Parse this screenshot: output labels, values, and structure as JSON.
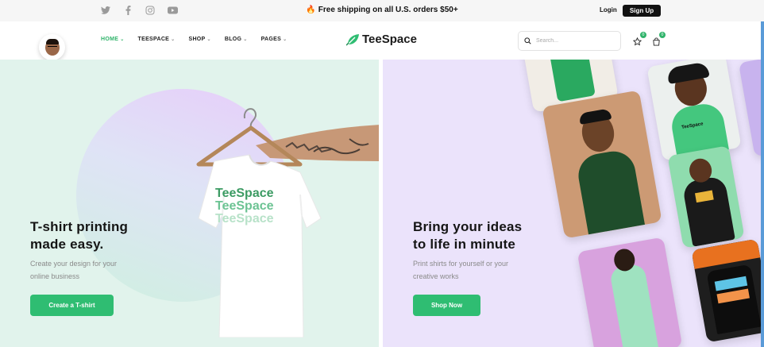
{
  "topbar": {
    "social": [
      "twitter-icon",
      "facebook-icon",
      "instagram-icon",
      "youtube-icon"
    ],
    "promo": "Free shipping on all U.S. orders $50+",
    "login": "Login",
    "signup": "Sign Up"
  },
  "nav": {
    "items": [
      {
        "label": "HOME",
        "active": true
      },
      {
        "label": "TEESPACE",
        "active": false
      },
      {
        "label": "SHOP",
        "active": false
      },
      {
        "label": "BLOG",
        "active": false
      },
      {
        "label": "PAGES",
        "active": false
      }
    ],
    "brand": "TeeSpace",
    "search_placeholder": "Search...",
    "wishlist_count": "0",
    "cart_count": "0"
  },
  "hero_left": {
    "headline_line1": "T-shirt printing",
    "headline_line2": "made easy.",
    "sub_line1": "Create your design for your",
    "sub_line2": "online business",
    "button": "Create a T-shirt",
    "shirt_print": [
      "TeeSpace",
      "TeeSpace",
      "TeeSpace"
    ]
  },
  "hero_right": {
    "headline_line1": "Bring your ideas",
    "headline_line2": "to life in minute",
    "sub_line1": "Print shirts for yourself or your",
    "sub_line2": "creative works",
    "button": "Shop Now",
    "hoodie_print": "TeeSpace"
  },
  "colors": {
    "accent": "#2fbd72",
    "left_bg": "#e1f3ec",
    "right_bg": "#ebe3fb"
  }
}
